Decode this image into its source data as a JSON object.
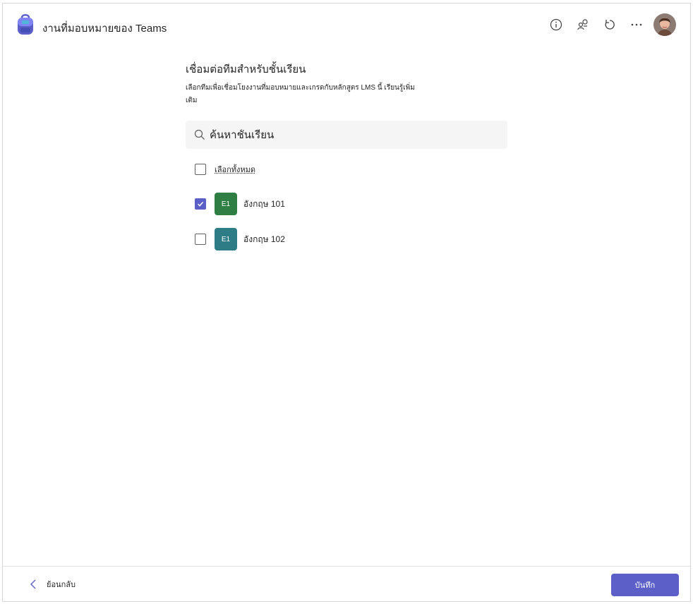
{
  "app": {
    "title": "งานที่มอบหมายของ Teams",
    "logo_icon": "backpack-icon"
  },
  "header": {
    "actions": [
      {
        "name": "info-icon"
      },
      {
        "name": "link-share-icon"
      },
      {
        "name": "refresh-icon"
      },
      {
        "name": "more-options-icon"
      }
    ],
    "avatar": "user-avatar"
  },
  "main": {
    "title": "เชื่อมต่อทีมสำหรับชั้นเรียน",
    "description": "เลือกทีมเพื่อเชื่อมโยงงานที่มอบหมายและเกรดกับหลักสูตร LMS นี้ เรียนรู้เพิ่มเติม",
    "search": {
      "placeholder": "ค้นหาชั้นเรียน",
      "value": ""
    },
    "select_all_label": "เลือกทั้งหมด",
    "classes": [
      {
        "initials": "E1",
        "name": "อังกฤษ 101",
        "checked": true,
        "color": "#2f7f45"
      },
      {
        "initials": "E1",
        "name": "อังกฤษ 102",
        "checked": false,
        "color": "#2e7d86"
      }
    ]
  },
  "footer": {
    "back_label": "ย้อนกลับ",
    "save_label": "บันทึก"
  },
  "colors": {
    "accent": "#5b5fc7"
  }
}
